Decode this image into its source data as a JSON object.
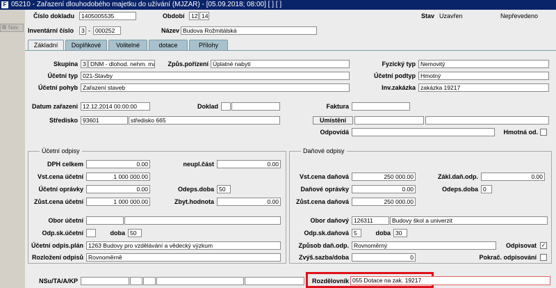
{
  "window": {
    "title": "05210 - Zařazení dlouhodobého majetku do užívání (MJZAR) - [05.09.2018; 08:00]  [ ]  [ ]",
    "nav_label": "Nav"
  },
  "header": {
    "cislo_dokladu_label": "Číslo dokladu",
    "cislo_dokladu": "1405005535",
    "obdobi_label": "Období",
    "obdobi_rok": "12",
    "obdobi_mesic": "14",
    "stav_label": "Stav",
    "stav": "Uzavřen",
    "nepredevedeno": "Nepřevedeno",
    "inventarni_cislo_label": "Inventární číslo",
    "inv_prefix": "3",
    "inv_sep": "-",
    "inv_cislo": "000252",
    "nazev_label": "Název",
    "nazev": "Budova Rožmitálská"
  },
  "tabs": [
    {
      "label": "Základní"
    },
    {
      "label": "Doplňkové"
    },
    {
      "label": "Volitelné"
    },
    {
      "label": "dotace"
    },
    {
      "label": "Přílohy"
    }
  ],
  "zakladni": {
    "skupina_label": "Skupina",
    "skupina_kod": "3",
    "skupina_nazev": "DNM - dlohod. nehm. ma",
    "zpus_porizeni_label": "Způs.pořízení",
    "zpus_porizeni": "Úplatné nabytí",
    "fyzicky_typ_label": "Fyzický typ",
    "fyzicky_typ": "Nemovitý",
    "ucetni_typ_label": "Účetní typ",
    "ucetni_typ": "021-Stavby",
    "ucetni_podtyp_label": "Účetní podtyp",
    "ucetni_podtyp": "Hmotný",
    "ucetni_pohyb_label": "Účetní pohyb",
    "ucetni_pohyb": "Zařazení staveb",
    "inv_zakazka_label": "Inv.zakázka",
    "inv_zakazka": "zakázka 19217",
    "datum_zarazeni_label": "Datum zařazení",
    "datum_zarazeni": "12.12.2014 00:00:00",
    "doklad_label": "Doklad",
    "faktura_label": "Faktura",
    "stredisko_label": "Středisko",
    "stredisko_kod": "93601",
    "stredisko_nazev": "středisko 665",
    "umisteni_label": "Umístění",
    "odpovida_label": "Odpovídá",
    "hmotna_od_label": "Hmotná od."
  },
  "ucetni_odpisy": {
    "title": "Účetní odpisy",
    "dph_celkem_label": "DPH celkem",
    "dph_celkem": "0.00",
    "neupl_cast_label": "neupl.část",
    "neupl_cast": "0.00",
    "vst_cena_label": "Vst.cena účetní",
    "vst_cena": "1 000 000.00",
    "ucetni_opravky_label": "Účetní oprávky",
    "ucetni_opravky": "0.00",
    "odeps_doba_label": "Odeps.doba",
    "odeps_doba": "50",
    "zust_cena_label": "Zůst.cena účetní",
    "zust_cena": "1 000 000.00",
    "zbyt_hodnota_label": "Zbyt.hodnota",
    "zbyt_hodnota": "0.00",
    "obor_label": "Obor účetní",
    "odp_sk_label": "Odp.sk.účetní",
    "doba_label": "doba",
    "doba": "50",
    "odpis_plan_label": "Účetní odpis.plán",
    "odpis_plan": "1263 Budovy pro vzdělávání a vědecký výzkum",
    "rozlozeni_label": "Rozložení odpisů",
    "rozlozeni": "Rovnoměrně"
  },
  "danove_odpisy": {
    "title": "Daňové odpisy",
    "vst_cena_label": "Vst.cena daňová",
    "vst_cena": "250 000.00",
    "zakl_dan_label": "Zákl.daň.odp.",
    "zakl_dan": "0.00",
    "danove_opravky_label": "Daňové oprávky",
    "danove_opravky": "0.00",
    "odeps_doba_label": "Odeps.doba",
    "odeps_doba": "0",
    "zust_cena_label": "Zůst.cena daňová",
    "zust_cena": "250 000.00",
    "obor_label": "Obor daňový",
    "obor_kod": "126311",
    "obor_nazev": "Budovy škol a univerzit",
    "odp_sk_label": "Odp.sk.daňová",
    "odp_sk": "5",
    "doba_label": "doba",
    "doba": "30",
    "zpusob_label": "Způsob daň.odp.",
    "zpusob": "Rovnoměrný",
    "odpisovat_label": "Odpisovat",
    "odpisovat_mark": "✓",
    "zvys_sazba_label": "Zvýš.sazba/doba",
    "zvys_sazba": "0",
    "pokrac_label": "Pokrač. odpisování"
  },
  "footer": {
    "nsu_label": "NSu/TA/A/KP",
    "rozdelovnik_label": "Rozdělovník",
    "rozdelovnik": "055 Dotace na zak. 19217"
  },
  "colors": {
    "title_bar": "#0a246a",
    "tab_inactive": "#a9c1cc",
    "highlight": "#e0101a"
  }
}
